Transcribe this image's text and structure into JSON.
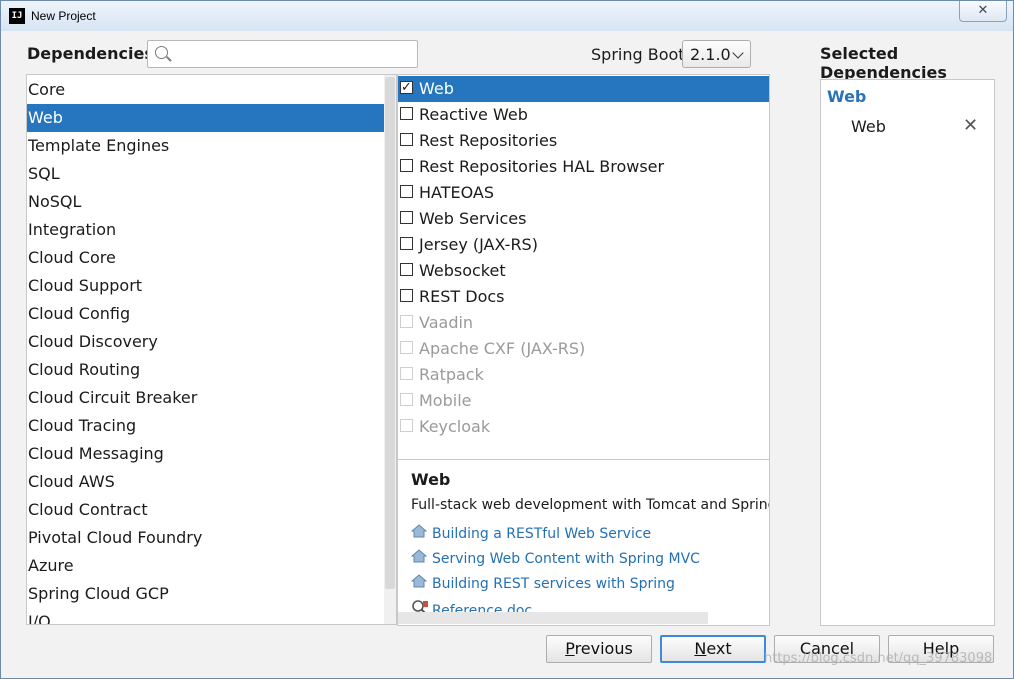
{
  "window": {
    "title": "New Project",
    "app_icon": "IJ",
    "close_glyph": "✕"
  },
  "header": {
    "dependencies_label": "Dependencies",
    "search_value": "",
    "spring_boot_label": "Spring Boot",
    "spring_boot_version": "2.1.0",
    "selected_label": "Selected Dependencies"
  },
  "categories": [
    {
      "label": "Core",
      "selected": false
    },
    {
      "label": "Web",
      "selected": true
    },
    {
      "label": "Template Engines",
      "selected": false
    },
    {
      "label": "SQL",
      "selected": false
    },
    {
      "label": "NoSQL",
      "selected": false
    },
    {
      "label": "Integration",
      "selected": false
    },
    {
      "label": "Cloud Core",
      "selected": false
    },
    {
      "label": "Cloud Support",
      "selected": false
    },
    {
      "label": "Cloud Config",
      "selected": false
    },
    {
      "label": "Cloud Discovery",
      "selected": false
    },
    {
      "label": "Cloud Routing",
      "selected": false
    },
    {
      "label": "Cloud Circuit Breaker",
      "selected": false
    },
    {
      "label": "Cloud Tracing",
      "selected": false
    },
    {
      "label": "Cloud Messaging",
      "selected": false
    },
    {
      "label": "Cloud AWS",
      "selected": false
    },
    {
      "label": "Cloud Contract",
      "selected": false
    },
    {
      "label": "Pivotal Cloud Foundry",
      "selected": false
    },
    {
      "label": "Azure",
      "selected": false
    },
    {
      "label": "Spring Cloud GCP",
      "selected": false
    },
    {
      "label": "I/O",
      "selected": false
    }
  ],
  "dependencies": [
    {
      "label": "Web",
      "checked": true,
      "enabled": true,
      "selected": true
    },
    {
      "label": "Reactive Web",
      "checked": false,
      "enabled": true,
      "selected": false
    },
    {
      "label": "Rest Repositories",
      "checked": false,
      "enabled": true,
      "selected": false
    },
    {
      "label": "Rest Repositories HAL Browser",
      "checked": false,
      "enabled": true,
      "selected": false
    },
    {
      "label": "HATEOAS",
      "checked": false,
      "enabled": true,
      "selected": false
    },
    {
      "label": "Web Services",
      "checked": false,
      "enabled": true,
      "selected": false
    },
    {
      "label": "Jersey (JAX-RS)",
      "checked": false,
      "enabled": true,
      "selected": false
    },
    {
      "label": "Websocket",
      "checked": false,
      "enabled": true,
      "selected": false
    },
    {
      "label": "REST Docs",
      "checked": false,
      "enabled": true,
      "selected": false
    },
    {
      "label": "Vaadin",
      "checked": false,
      "enabled": false,
      "selected": false
    },
    {
      "label": "Apache CXF (JAX-RS)",
      "checked": false,
      "enabled": false,
      "selected": false
    },
    {
      "label": "Ratpack",
      "checked": false,
      "enabled": false,
      "selected": false
    },
    {
      "label": "Mobile",
      "checked": false,
      "enabled": false,
      "selected": false
    },
    {
      "label": "Keycloak",
      "checked": false,
      "enabled": false,
      "selected": false
    }
  ],
  "info": {
    "title": "Web",
    "description": "Full-stack web development with Tomcat and Spring",
    "links": [
      {
        "label": "Building a RESTful Web Service",
        "icon": "guide-icon"
      },
      {
        "label": "Serving Web Content with Spring MVC",
        "icon": "guide-icon"
      },
      {
        "label": "Building REST services with Spring",
        "icon": "guide-icon"
      },
      {
        "label": "Reference doc",
        "icon": "reference-doc-icon"
      }
    ]
  },
  "selected_dependencies": {
    "group": "Web",
    "items": [
      {
        "label": "Web",
        "remove_glyph": "✕"
      }
    ]
  },
  "buttons": {
    "previous": {
      "mnemonic": "P",
      "rest": "revious"
    },
    "next": {
      "mnemonic": "N",
      "rest": "ext"
    },
    "cancel": "Cancel",
    "help": "Help"
  },
  "watermark": "https://blog.csdn.net/qq_39783098",
  "colors": {
    "selection": "#2675bf",
    "link": "#2470b3",
    "group": "#2a73b8"
  }
}
